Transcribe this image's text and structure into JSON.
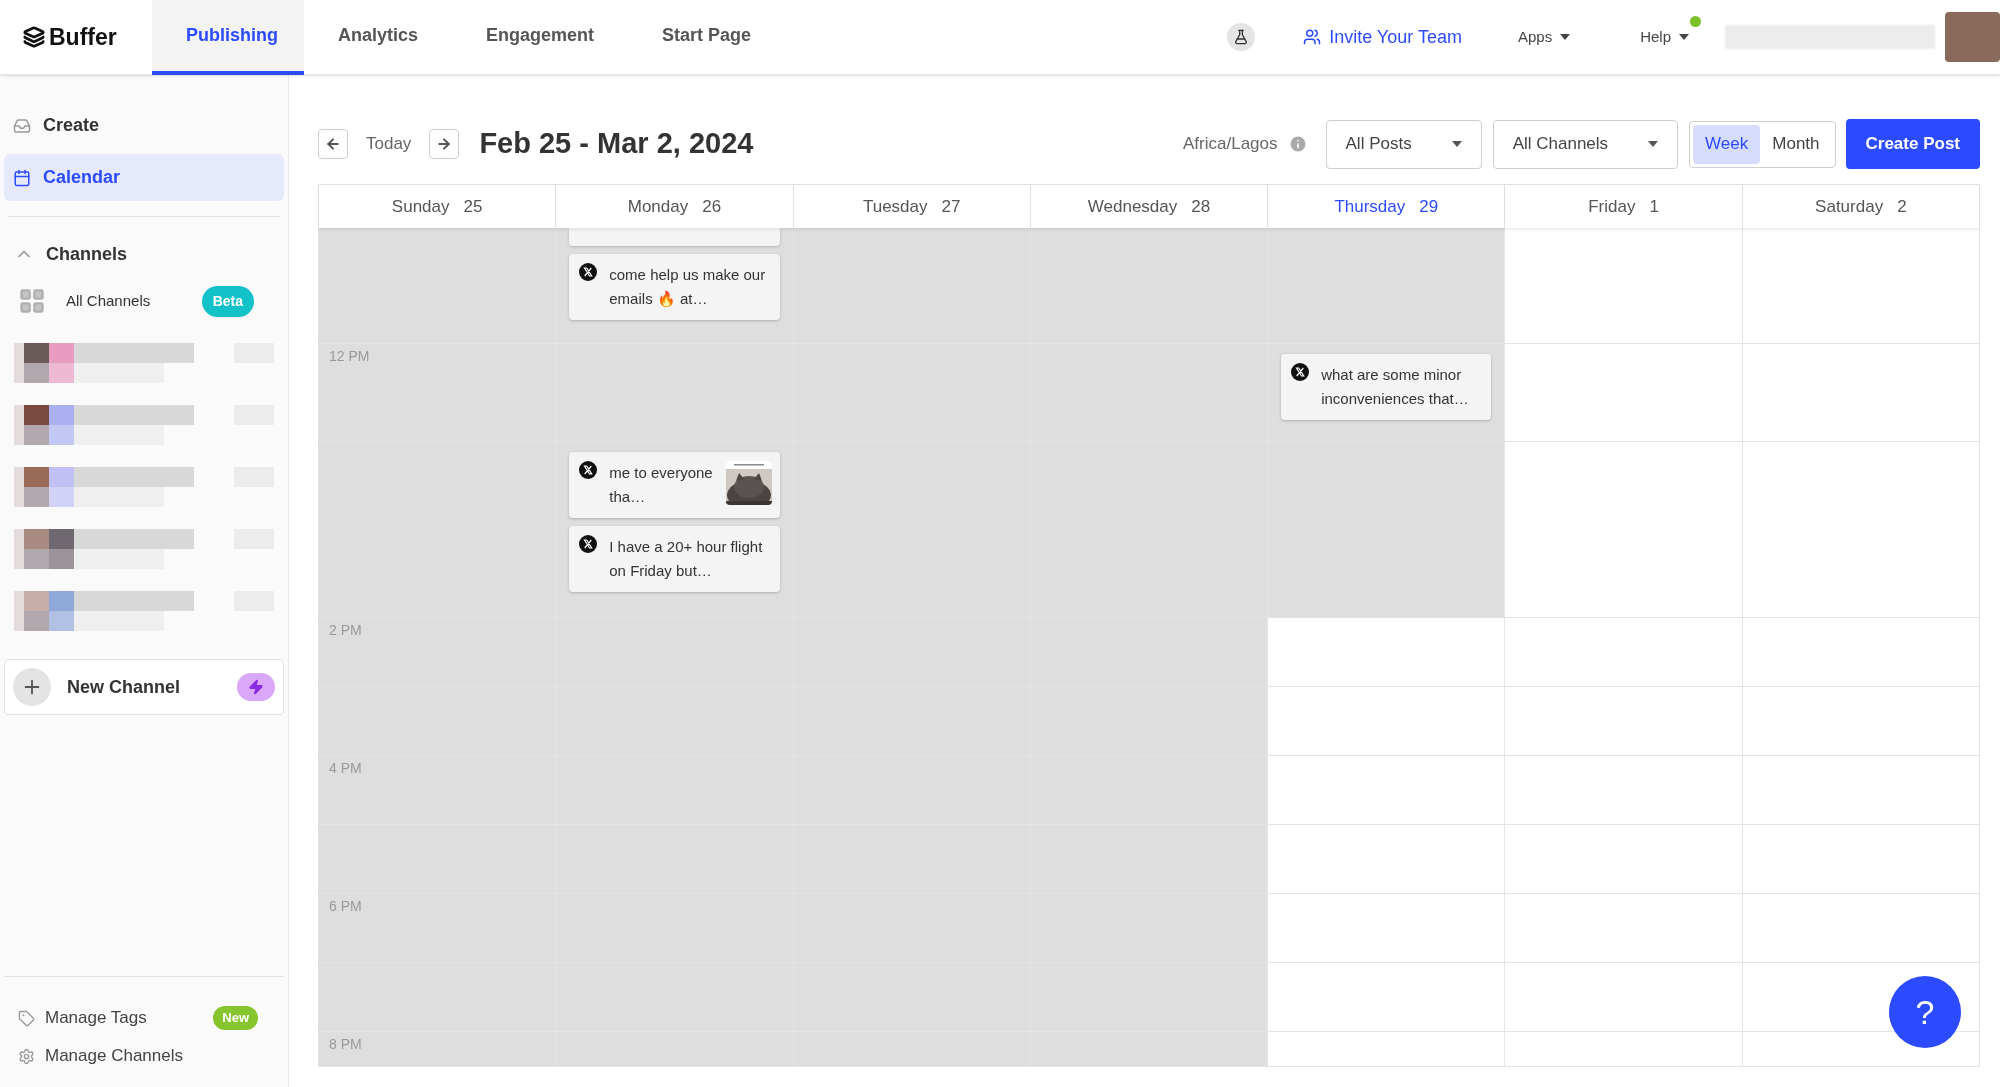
{
  "nav": {
    "logo": "Buffer",
    "tabs": [
      {
        "label": "Publishing",
        "selected": true
      },
      {
        "label": "Analytics",
        "selected": false
      },
      {
        "label": "Engagement",
        "selected": false
      },
      {
        "label": "Start Page",
        "selected": false
      }
    ],
    "invite": "Invite Your Team",
    "menus": [
      {
        "label": "Apps",
        "notification": false
      },
      {
        "label": "Help",
        "notification": true
      }
    ]
  },
  "sidebar": {
    "items": [
      {
        "label": "Create",
        "kind": "create",
        "selected": false
      },
      {
        "label": "Calendar",
        "kind": "calendar",
        "selected": true
      }
    ],
    "channels": {
      "title": "Channels",
      "expanded": true,
      "all_label": "All Channels",
      "all_badge": "Beta",
      "new_channel": "New Channel"
    },
    "footer": [
      {
        "label": "Manage Tags",
        "kind": "tags",
        "badge": "New"
      },
      {
        "label": "Manage Channels",
        "kind": "settings"
      }
    ]
  },
  "toolbar": {
    "today": "Today",
    "range": "Feb 25 - Mar 2, 2024",
    "timezone": "Africa/Lagos",
    "filters": [
      "All Posts",
      "All Channels"
    ],
    "views": [
      {
        "label": "Week",
        "selected": true
      },
      {
        "label": "Month",
        "selected": false
      }
    ],
    "create": "Create Post"
  },
  "calendar": {
    "days": [
      {
        "name": "Sunday",
        "date": "25",
        "today": false
      },
      {
        "name": "Monday",
        "date": "26",
        "today": false
      },
      {
        "name": "Tuesday",
        "date": "27",
        "today": false
      },
      {
        "name": "Wednesday",
        "date": "28",
        "today": false
      },
      {
        "name": "Thursday",
        "date": "29",
        "today": true
      },
      {
        "name": "Friday",
        "date": "1",
        "today": false
      },
      {
        "name": "Saturday",
        "date": "2",
        "today": false
      }
    ],
    "rows": [
      {
        "cells": [
          {
            "past": true
          },
          {
            "past": true,
            "posts": [
              {
                "kind": "clipped"
              },
              {
                "kind": "post",
                "text": "come help us make our emails 🔥 at…"
              }
            ]
          },
          {
            "past": true
          },
          {
            "past": true
          },
          {
            "past": true
          },
          {
            "past": false
          },
          {
            "past": false
          }
        ]
      },
      {
        "label": "12 PM",
        "cells": [
          {
            "past": true
          },
          {
            "past": true
          },
          {
            "past": true
          },
          {
            "past": true
          },
          {
            "past": true,
            "posts": [
              {
                "kind": "post",
                "text": "what are some minor inconveniences that…"
              }
            ]
          },
          {
            "past": false
          },
          {
            "past": false
          }
        ]
      },
      {
        "cells": [
          {
            "past": true
          },
          {
            "past": true,
            "posts": [
              {
                "kind": "post",
                "text": "me to everyone tha…",
                "image": true
              },
              {
                "kind": "post",
                "text": "I have a 20+ hour flight on Friday but…"
              }
            ]
          },
          {
            "past": true
          },
          {
            "past": true
          },
          {
            "past": true
          },
          {
            "past": false
          },
          {
            "past": false
          }
        ]
      },
      {
        "label": "2 PM",
        "cells": [
          {
            "past": true
          },
          {
            "past": true
          },
          {
            "past": true
          },
          {
            "past": true
          },
          {
            "past": false
          },
          {
            "past": false
          },
          {
            "past": false
          }
        ]
      },
      {
        "cells": [
          {
            "past": true
          },
          {
            "past": true
          },
          {
            "past": true
          },
          {
            "past": true
          },
          {
            "past": false
          },
          {
            "past": false
          },
          {
            "past": false
          }
        ]
      },
      {
        "label": "4 PM",
        "cells": [
          {
            "past": true
          },
          {
            "past": true
          },
          {
            "past": true
          },
          {
            "past": true
          },
          {
            "past": false
          },
          {
            "past": false
          },
          {
            "past": false
          }
        ]
      },
      {
        "cells": [
          {
            "past": true
          },
          {
            "past": true
          },
          {
            "past": true
          },
          {
            "past": true
          },
          {
            "past": false
          },
          {
            "past": false
          },
          {
            "past": false
          }
        ]
      },
      {
        "label": "6 PM",
        "cells": [
          {
            "past": true
          },
          {
            "past": true
          },
          {
            "past": true
          },
          {
            "past": true
          },
          {
            "past": false
          },
          {
            "past": false
          },
          {
            "past": false
          }
        ]
      },
      {
        "cells": [
          {
            "past": true
          },
          {
            "past": true
          },
          {
            "past": true
          },
          {
            "past": true
          },
          {
            "past": false
          },
          {
            "past": false
          },
          {
            "past": false
          }
        ]
      },
      {
        "label": "8 PM",
        "cells": [
          {
            "past": true
          },
          {
            "past": true
          },
          {
            "past": true
          },
          {
            "past": true
          },
          {
            "past": false
          },
          {
            "past": false
          },
          {
            "past": false
          }
        ]
      }
    ]
  },
  "help_button": "?"
}
